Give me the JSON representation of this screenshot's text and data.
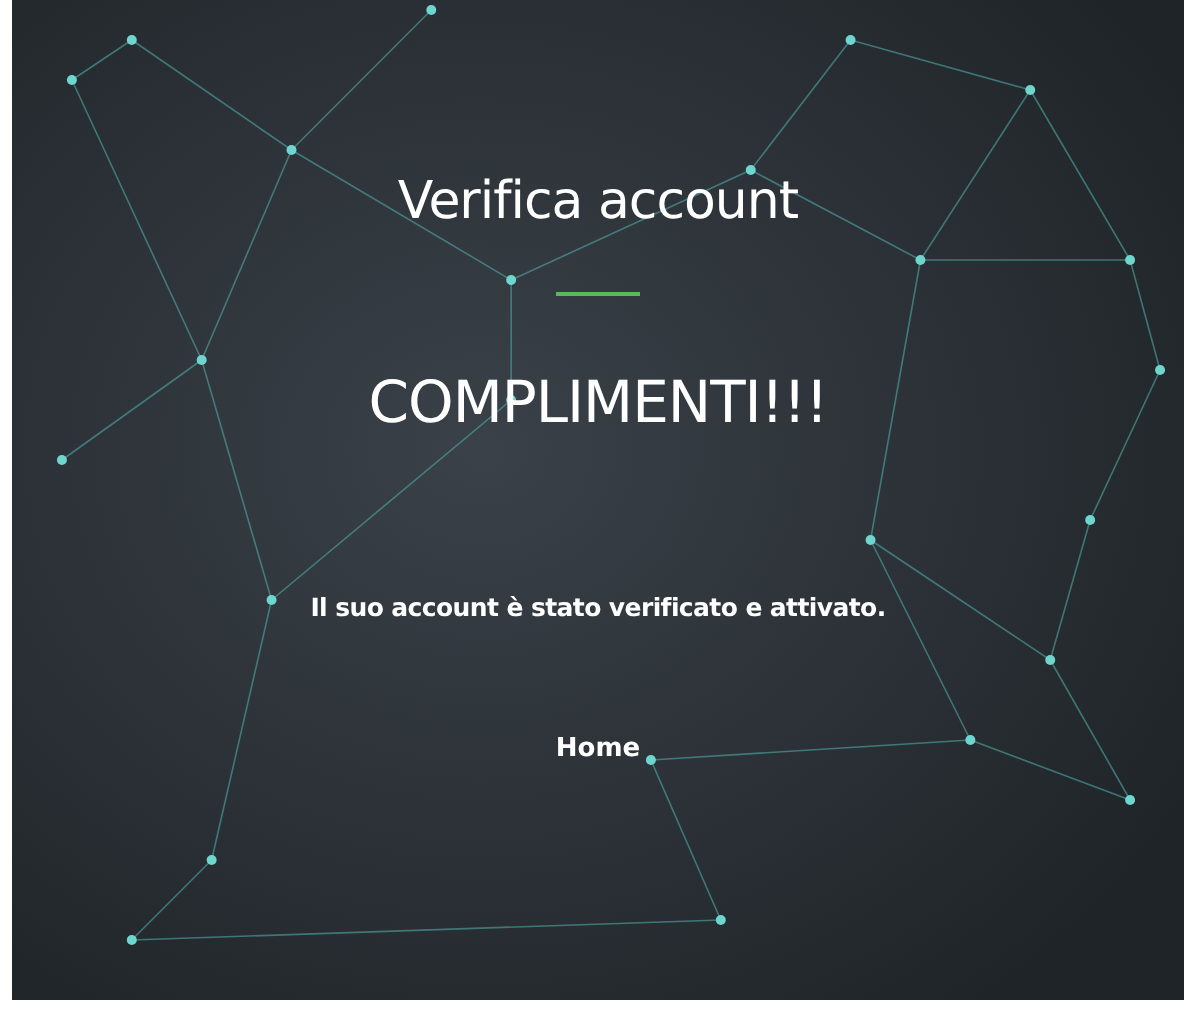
{
  "page": {
    "title": "Verifica account",
    "headline": "COMPLIMENTI!!!",
    "message": "Il suo account è stato verificato e attivato.",
    "link": "Home"
  }
}
